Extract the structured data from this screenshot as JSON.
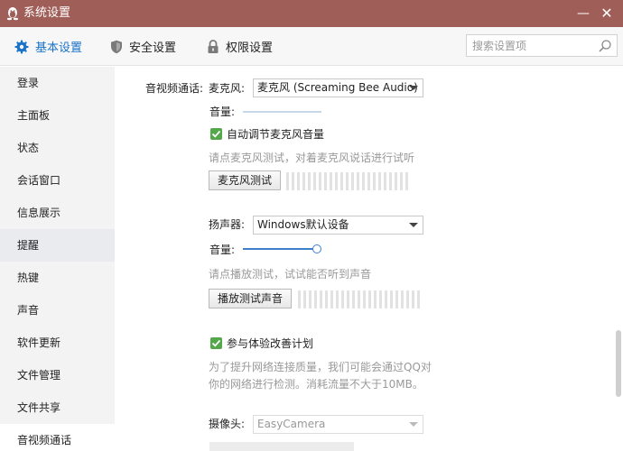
{
  "window": {
    "title": "系统设置",
    "minimize_glyph": "—",
    "close_glyph": "✕",
    "logo_icon": "qq-penguin-icon"
  },
  "tabs": [
    {
      "label": "基本设置",
      "icon": "gear-icon",
      "active": true
    },
    {
      "label": "安全设置",
      "icon": "shield-icon",
      "active": false
    },
    {
      "label": "权限设置",
      "icon": "lock-icon",
      "active": false
    }
  ],
  "search": {
    "placeholder": "搜索设置项",
    "value": "",
    "icon": "search-icon"
  },
  "sidebar": {
    "items": [
      {
        "label": "登录"
      },
      {
        "label": "主面板"
      },
      {
        "label": "状态"
      },
      {
        "label": "会话窗口"
      },
      {
        "label": "信息展示"
      },
      {
        "label": "提醒",
        "state": "hovered"
      },
      {
        "label": "热键"
      },
      {
        "label": "声音"
      },
      {
        "label": "软件更新"
      },
      {
        "label": "文件管理"
      },
      {
        "label": "文件共享"
      },
      {
        "label": "音视频通话",
        "state": "selected"
      }
    ]
  },
  "av": {
    "section_label": "音视频通话:",
    "mic": {
      "label": "麦克风:",
      "device": "麦克风 (Screaming Bee Audio)",
      "volume_label": "音量:",
      "volume_level": 0,
      "auto_adjust_label": "自动调节麦克风音量",
      "auto_adjust_checked": true,
      "test_hint": "请点麦克风测试，对着麦克风说话进行试听",
      "test_button": "麦克风测试"
    },
    "speaker": {
      "label": "扬声器:",
      "device": "Windows默认设备",
      "volume_label": "音量:",
      "volume_level": 1.0,
      "test_hint": "请点播放测试，试试能否听到声音",
      "test_button": "播放测试声音"
    },
    "improve": {
      "label": "参与体验改善计划",
      "checked": true,
      "desc_line1": "为了提升网络连接质量，我们可能会通过QQ对",
      "desc_line2": "你的网络进行检测。消耗流量不大于10MB。"
    },
    "camera": {
      "label": "摄像头:",
      "device": "EasyCamera"
    }
  },
  "colors": {
    "titlebar": "#a05e58",
    "accent": "#1a73c8",
    "checkbox": "#52a84a",
    "hint_text": "#999999"
  }
}
